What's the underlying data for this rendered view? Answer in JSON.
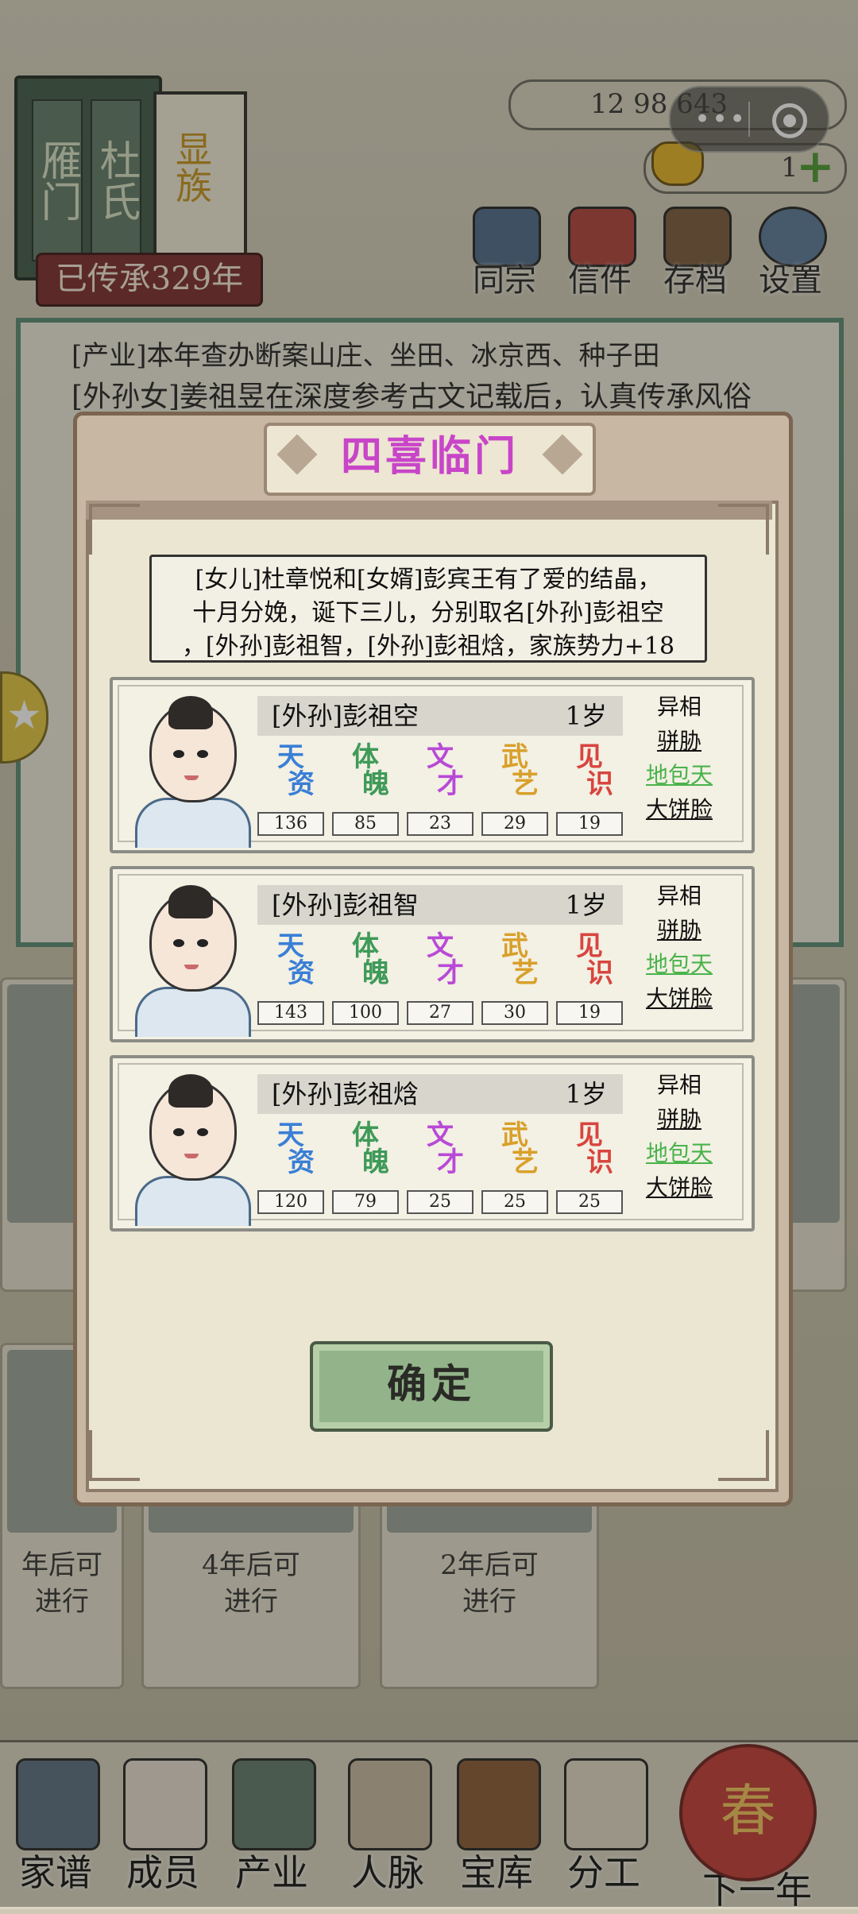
{
  "header": {
    "clan_title_1": "雁门",
    "clan_title_2": "杜氏",
    "clan_rank": "显族",
    "inherit_label": "已传承329年",
    "currency_1": "12 98 643",
    "currency_2": "1",
    "top_nav": [
      "同宗",
      "信件",
      "存档",
      "设置"
    ]
  },
  "log": {
    "line_0": "[产业]本年查办断案山庄、坐田、冰京西、种子田",
    "line_1": "[外孙女]姜祖昱在深度参考古文记载后，认真传承风俗"
  },
  "bg_cards": {
    "c1": "年可\n进行",
    "c2": "年后可\n进行",
    "c3": "4年后可\n进行",
    "c4": "2年后可\n进行"
  },
  "bottom_nav": [
    "家谱",
    "成员",
    "产业",
    "人脉",
    "宝库",
    "分工",
    "下一年"
  ],
  "spring_icon": "春",
  "modal": {
    "title": "四喜临门",
    "message_line1": "[女儿]杜章悦和[女婿]彭宾王有了爱的结晶，",
    "message_line2": "十月分娩，诞下三儿，分别取名[外孙]彭祖空",
    "message_line3": "，[外孙]彭祖智，[外孙]彭祖焓，家族势力+18",
    "stat_labels": [
      [
        "天",
        "资"
      ],
      [
        "体",
        "魄"
      ],
      [
        "文",
        "才"
      ],
      [
        "武",
        "艺"
      ],
      [
        "见",
        "识"
      ]
    ],
    "stat_colors": [
      "#3a7fd6",
      "#3f9a58",
      "#b84ad6",
      "#d8a02a",
      "#d8453f"
    ],
    "trait_header": "异相",
    "children": [
      {
        "name": "[外孙]彭祖空",
        "age": "1岁",
        "stats": [
          "136",
          "85",
          "23",
          "29",
          "19"
        ],
        "traits": [
          "骈胁",
          "地包天",
          "大饼脸"
        ]
      },
      {
        "name": "[外孙]彭祖智",
        "age": "1岁",
        "stats": [
          "143",
          "100",
          "27",
          "30",
          "19"
        ],
        "traits": [
          "骈胁",
          "地包天",
          "大饼脸"
        ]
      },
      {
        "name": "[外孙]彭祖焓",
        "age": "1岁",
        "stats": [
          "120",
          "79",
          "25",
          "25",
          "25"
        ],
        "traits": [
          "骈胁",
          "地包天",
          "大饼脸"
        ]
      }
    ],
    "confirm_label": "确定"
  }
}
